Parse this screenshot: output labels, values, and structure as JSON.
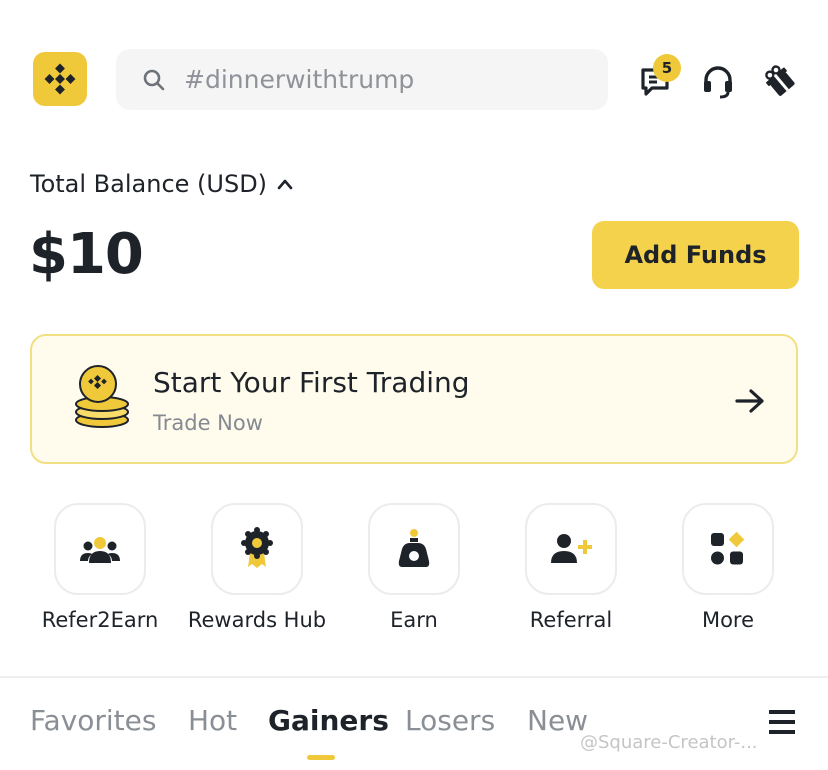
{
  "header": {
    "search_placeholder": "#dinnerwithtrump",
    "notification_count": "5",
    "icons": [
      "binance-logo-icon",
      "search-icon",
      "messages-icon",
      "support-headset-icon",
      "gift-icon"
    ]
  },
  "balance": {
    "label": "Total Balance (USD)",
    "value": "$10",
    "add_funds_label": "Add Funds"
  },
  "banner": {
    "title": "Start Your First Trading",
    "subtitle": "Trade Now"
  },
  "shortcuts": [
    {
      "label": "Refer2Earn",
      "icon": "refer-group-icon"
    },
    {
      "label": "Rewards Hub",
      "icon": "rewards-medal-icon"
    },
    {
      "label": "Earn",
      "icon": "earn-bag-icon"
    },
    {
      "label": "Referral",
      "icon": "add-user-icon"
    },
    {
      "label": "More",
      "icon": "more-grid-icon"
    }
  ],
  "tabs": [
    {
      "label": "Favorites",
      "active": false
    },
    {
      "label": "Hot",
      "active": false
    },
    {
      "label": "Gainers",
      "active": true
    },
    {
      "label": "Losers",
      "active": false
    },
    {
      "label": "New",
      "active": false
    }
  ],
  "colors": {
    "brand_yellow": "#F0C93A",
    "button_yellow": "#F5D24C",
    "banner_bg": "#FFFCEE",
    "text_primary": "#1E2329",
    "text_muted": "#8A8F96"
  },
  "watermark": "@Square-Creator-..."
}
